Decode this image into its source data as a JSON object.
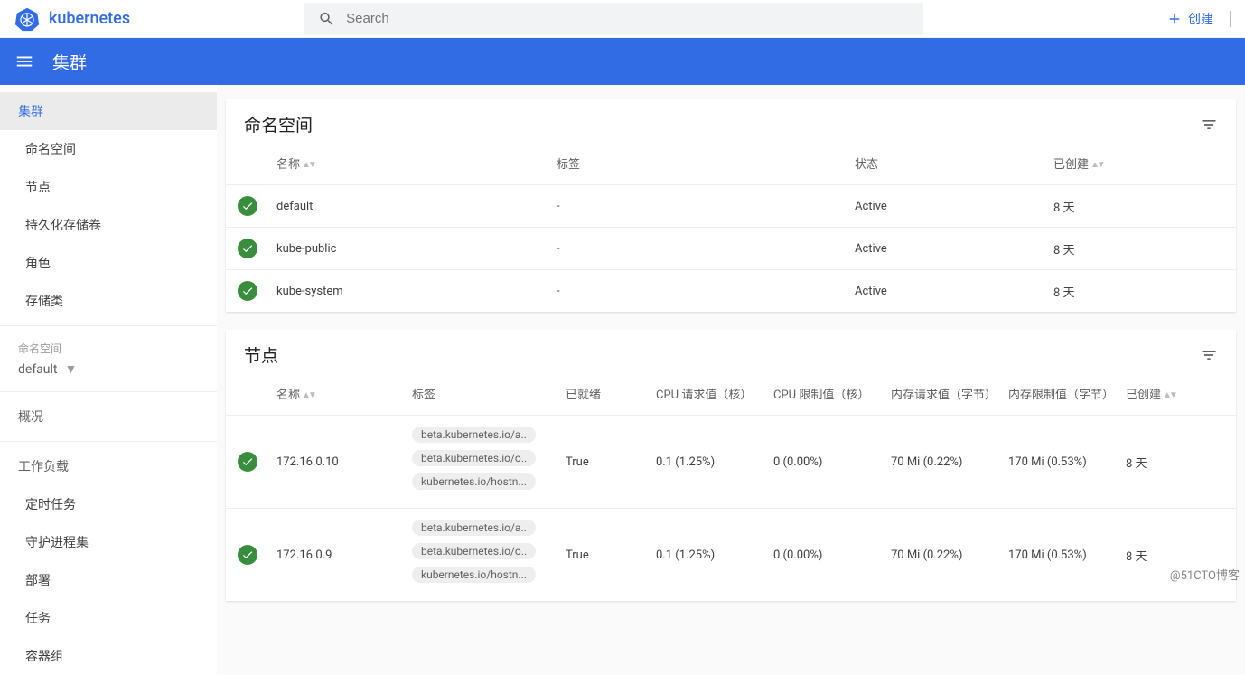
{
  "topbar": {
    "app_name": "kubernetes",
    "search_placeholder": "Search",
    "create_label": "创建"
  },
  "subbar": {
    "title": "集群"
  },
  "sidebar": {
    "cluster_header": "集群",
    "cluster_items": [
      {
        "label": "命名空间"
      },
      {
        "label": "节点"
      },
      {
        "label": "持久化存储卷"
      },
      {
        "label": "角色"
      },
      {
        "label": "存储类"
      }
    ],
    "ns_label": "命名空间",
    "ns_selected": "default",
    "overview": "概况",
    "workloads_header": "工作负载",
    "workloads_items": [
      {
        "label": "定时任务"
      },
      {
        "label": "守护进程集"
      },
      {
        "label": "部署"
      },
      {
        "label": "任务"
      },
      {
        "label": "容器组"
      }
    ]
  },
  "namespaces_card": {
    "title": "命名空间",
    "columns": {
      "name": "名称",
      "labels": "标签",
      "status": "状态",
      "created": "已创建"
    },
    "rows": [
      {
        "name": "default",
        "labels": "-",
        "status": "Active",
        "created": "8 天"
      },
      {
        "name": "kube-public",
        "labels": "-",
        "status": "Active",
        "created": "8 天"
      },
      {
        "name": "kube-system",
        "labels": "-",
        "status": "Active",
        "created": "8 天"
      }
    ]
  },
  "nodes_card": {
    "title": "节点",
    "columns": {
      "name": "名称",
      "labels": "标签",
      "ready": "已就绪",
      "cpu_req": "CPU 请求值（核）",
      "cpu_lim": "CPU 限制值（核）",
      "mem_req": "内存请求值（字节）",
      "mem_lim": "内存限制值（字节）",
      "created": "已创建"
    },
    "chips": [
      "beta.kubernetes.io/a..",
      "beta.kubernetes.io/o..",
      "kubernetes.io/hostn..."
    ],
    "rows": [
      {
        "name": "172.16.0.10",
        "ready": "True",
        "cpu_req": "0.1 (1.25%)",
        "cpu_lim": "0 (0.00%)",
        "mem_req": "70 Mi (0.22%)",
        "mem_lim": "170 Mi (0.53%)",
        "created": "8 天"
      },
      {
        "name": "172.16.0.9",
        "ready": "True",
        "cpu_req": "0.1 (1.25%)",
        "cpu_lim": "0 (0.00%)",
        "mem_req": "70 Mi (0.22%)",
        "mem_lim": "170 Mi (0.53%)",
        "created": "8 天"
      }
    ]
  },
  "watermark": "@51CTO博客"
}
